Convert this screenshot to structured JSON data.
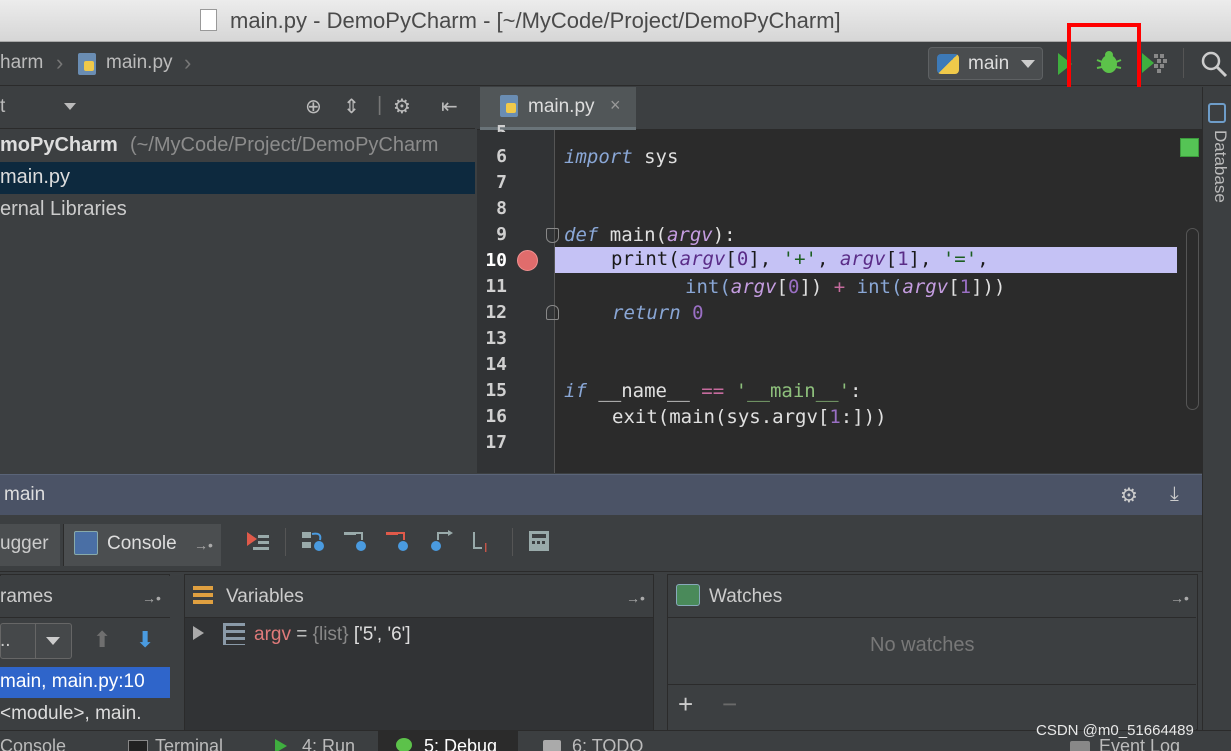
{
  "window": {
    "title": "main.py - DemoPyCharm - [~/MyCode/Project/DemoPyCharm]"
  },
  "navbar": {
    "breadcrumb_project": "harm",
    "breadcrumb_file": "main.py",
    "run_config": "main",
    "icons": [
      "run-icon",
      "debug-icon",
      "coverage-icon",
      "search-icon"
    ],
    "highlight_color": "#ff0000"
  },
  "project_panel": {
    "header_label": "t",
    "tree": [
      {
        "label": "moPyCharm",
        "path": "(~/MyCode/Project/DemoPyCharm"
      },
      {
        "label": "main.py",
        "selected": true
      },
      {
        "label": "ernal Libraries"
      }
    ]
  },
  "editor": {
    "tab_label": "main.py",
    "tab_close": "×",
    "line_numbers": [
      "6",
      "7",
      "8",
      "9",
      "10",
      "11",
      "12",
      "13",
      "14",
      "15",
      "16",
      "17"
    ],
    "top_partial_line": "5",
    "current_line": "10",
    "breakpoint_line": "10",
    "lines": {
      "l6": {
        "kw": "import",
        "rest": " sys"
      },
      "l9": {
        "kw": "def",
        "name": " main(",
        "param": "argv",
        "end": "):"
      },
      "l10": {
        "a": "print(",
        "p1": "argv",
        "b": "[",
        "n0": "0",
        "c": "], ",
        "s1": "'+'",
        "d": ", ",
        "p2": "argv",
        "e": "[",
        "n1": "1",
        "f": "], ",
        "s2": "'='",
        "g": ","
      },
      "l11": {
        "a": "int(",
        "p1": "argv",
        "b": "[",
        "n0": "0",
        "c": "]) ",
        "op": "+",
        "d": " int(",
        "p2": "argv",
        "e": "[",
        "n1": "1",
        "f": "]))"
      },
      "l12": {
        "kw": "return",
        "num": "0"
      },
      "l15": {
        "kw": "if",
        "a": " __name__ ",
        "op": "==",
        "s": "'__main__'",
        "end": ":"
      },
      "l16": {
        "a": "exit(main(sys.argv[",
        "n": "1",
        "b": ":]))"
      }
    }
  },
  "right_strip": {
    "label": "Database"
  },
  "debug_window": {
    "title": "main",
    "tabs": {
      "debugger": "ugger",
      "console": "Console"
    },
    "toolbar_icons": [
      "show-execution-point-icon",
      "step-over-icon",
      "step-into-icon",
      "step-into-my-code-icon",
      "force-step-into-icon",
      "step-out-icon",
      "run-to-cursor-icon",
      "evaluate-expression-icon"
    ],
    "frames": {
      "title": "rames",
      "combo": "..",
      "items": [
        "main, main.py:10",
        "<module>, main."
      ]
    },
    "variables": {
      "title": "Variables",
      "items": [
        {
          "name": "argv",
          "eq": " = ",
          "type": "{list}",
          "value": " ['5', '6']"
        }
      ]
    },
    "watches": {
      "title": "Watches",
      "empty": "No watches",
      "add": "+",
      "remove": "−"
    }
  },
  "bottom_tabs": [
    "Console",
    "Terminal",
    "4: Run",
    "5: Debug",
    "6: TODO",
    "Event Log"
  ],
  "watermark": "CSDN @m0_51664489"
}
